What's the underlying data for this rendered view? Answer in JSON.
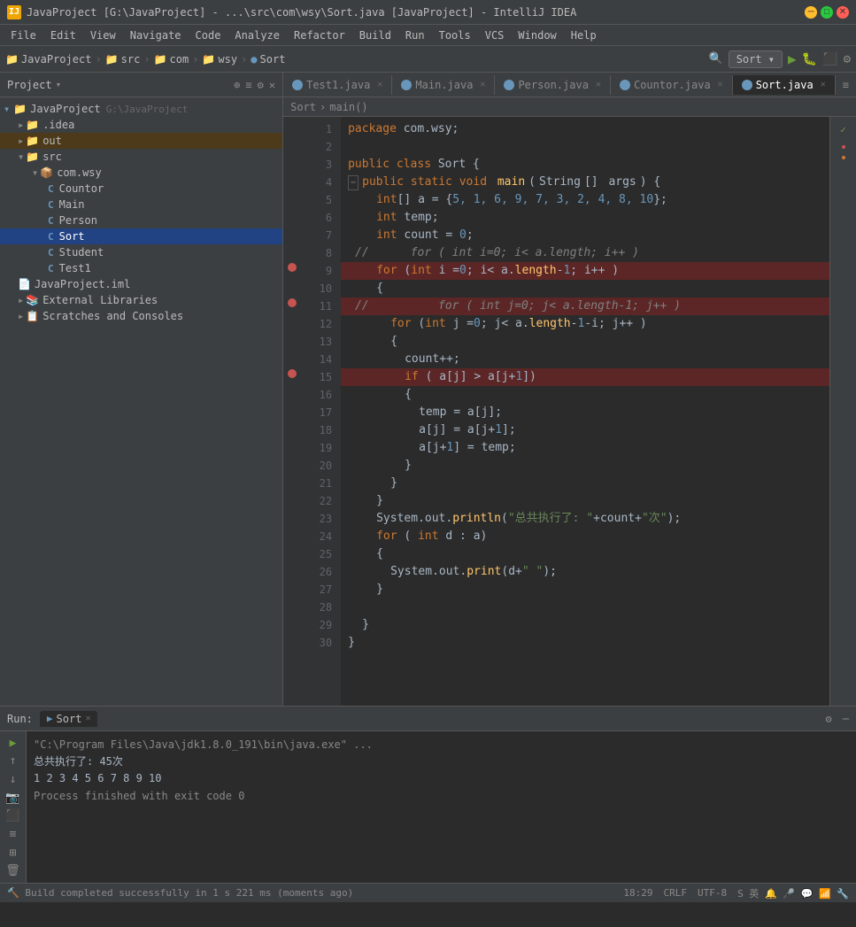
{
  "titleBar": {
    "title": "JavaProject [G:\\JavaProject] - ...\\src\\com\\wsy\\Sort.java [JavaProject] - IntelliJ IDEA",
    "appIconLabel": "IJ"
  },
  "menuBar": {
    "items": [
      "File",
      "Edit",
      "View",
      "Navigate",
      "Code",
      "Analyze",
      "Refactor",
      "Build",
      "Run",
      "Tools",
      "VCS",
      "Window",
      "Help"
    ]
  },
  "navBar": {
    "items": [
      "JavaProject",
      "src",
      "com",
      "wsy",
      "Sort"
    ],
    "sortBtn": "Sort ▾"
  },
  "projectPanel": {
    "title": "Project",
    "tree": [
      {
        "indent": 0,
        "icon": "▾",
        "iconColor": "#6897bb",
        "label": "JavaProject",
        "hint": "G:\\JavaProject",
        "type": "root"
      },
      {
        "indent": 1,
        "icon": "▸",
        "iconColor": "#cc7832",
        "label": ".idea",
        "type": "folder"
      },
      {
        "indent": 1,
        "icon": "▸",
        "iconColor": "#d09b2c",
        "label": "out",
        "type": "folder"
      },
      {
        "indent": 1,
        "icon": "▾",
        "iconColor": "#d09b2c",
        "label": "src",
        "type": "folder"
      },
      {
        "indent": 2,
        "icon": "▾",
        "iconColor": "#d09b2c",
        "label": "com.wsy",
        "type": "folder"
      },
      {
        "indent": 3,
        "icon": "C",
        "iconColor": "#6897bb",
        "label": "Countor",
        "type": "class"
      },
      {
        "indent": 3,
        "icon": "C",
        "iconColor": "#6897bb",
        "label": "Main",
        "type": "class"
      },
      {
        "indent": 3,
        "icon": "C",
        "iconColor": "#6897bb",
        "label": "Person",
        "type": "class"
      },
      {
        "indent": 3,
        "icon": "C",
        "iconColor": "#6897bb",
        "label": "Sort",
        "type": "class",
        "selected": true
      },
      {
        "indent": 3,
        "icon": "C",
        "iconColor": "#6897bb",
        "label": "Student",
        "type": "class"
      },
      {
        "indent": 3,
        "icon": "C",
        "iconColor": "#6897bb",
        "label": "Test1",
        "type": "class"
      },
      {
        "indent": 1,
        "icon": "📄",
        "iconColor": "#bbb",
        "label": "JavaProject.iml",
        "type": "file"
      },
      {
        "indent": 1,
        "icon": "▸",
        "iconColor": "#bbb",
        "label": "External Libraries",
        "type": "folder"
      },
      {
        "indent": 1,
        "icon": "📋",
        "iconColor": "#bbb",
        "label": "Scratches and Consoles",
        "type": "folder"
      }
    ]
  },
  "tabs": [
    {
      "label": "Test1.java",
      "iconColor": "#6897bb",
      "active": false
    },
    {
      "label": "Main.java",
      "iconColor": "#6897bb",
      "active": false
    },
    {
      "label": "Person.java",
      "iconColor": "#6897bb",
      "active": false
    },
    {
      "label": "Countor.java",
      "iconColor": "#6897bb",
      "active": false
    },
    {
      "label": "Sort.java",
      "iconColor": "#6897bb",
      "active": true
    }
  ],
  "breadcrumb": {
    "items": [
      "Sort",
      "›",
      "main()"
    ]
  },
  "codeLines": [
    {
      "num": 1,
      "text": "package com.wsy;",
      "highlight": false,
      "breakpoint": false
    },
    {
      "num": 2,
      "text": "",
      "highlight": false,
      "breakpoint": false
    },
    {
      "num": 3,
      "text": "public class Sort {",
      "highlight": false,
      "breakpoint": false
    },
    {
      "num": 4,
      "text": "    public static void main(String[] args) {",
      "highlight": false,
      "breakpoint": false
    },
    {
      "num": 5,
      "text": "        int[] a = {5, 1, 6, 9, 7, 3, 2, 4, 8, 10};",
      "highlight": false,
      "breakpoint": false
    },
    {
      "num": 6,
      "text": "        int temp;",
      "highlight": false,
      "breakpoint": false
    },
    {
      "num": 7,
      "text": "        int count = 0;",
      "highlight": false,
      "breakpoint": false
    },
    {
      "num": 8,
      "text": "//      for ( int i=0; i< a.length; i++ )",
      "highlight": false,
      "breakpoint": false,
      "comment": true
    },
    {
      "num": 9,
      "text": "        for (int i =0; i< a.length-1; i++ )",
      "highlight": true,
      "breakpoint": true
    },
    {
      "num": 10,
      "text": "        {",
      "highlight": false,
      "breakpoint": false
    },
    {
      "num": 11,
      "text": "//          for ( int j=0; j< a.length-1; j++ )",
      "highlight": true,
      "breakpoint": true,
      "comment": true
    },
    {
      "num": 12,
      "text": "            for (int j =0; j< a.length-1-i; j++ )",
      "highlight": false,
      "breakpoint": false
    },
    {
      "num": 13,
      "text": "            {",
      "highlight": false,
      "breakpoint": false
    },
    {
      "num": 14,
      "text": "                count++;",
      "highlight": false,
      "breakpoint": false
    },
    {
      "num": 15,
      "text": "                if ( a[j] > a[j+1])",
      "highlight": true,
      "breakpoint": true
    },
    {
      "num": 16,
      "text": "                {",
      "highlight": false,
      "breakpoint": false
    },
    {
      "num": 17,
      "text": "                    temp = a[j];",
      "highlight": false,
      "breakpoint": false
    },
    {
      "num": 18,
      "text": "                    a[j] = a[j+1];",
      "highlight": false,
      "breakpoint": false
    },
    {
      "num": 19,
      "text": "                    a[j+1] = temp;",
      "highlight": false,
      "breakpoint": false
    },
    {
      "num": 20,
      "text": "                }",
      "highlight": false,
      "breakpoint": false
    },
    {
      "num": 21,
      "text": "            }",
      "highlight": false,
      "breakpoint": false
    },
    {
      "num": 22,
      "text": "        }",
      "highlight": false,
      "breakpoint": false
    },
    {
      "num": 23,
      "text": "        System.out.println(\"总共执行了: \"+count+\"次\");",
      "highlight": false,
      "breakpoint": false
    },
    {
      "num": 24,
      "text": "        for ( int d : a)",
      "highlight": false,
      "breakpoint": false
    },
    {
      "num": 25,
      "text": "        {",
      "highlight": false,
      "breakpoint": false
    },
    {
      "num": 26,
      "text": "            System.out.print(d+\" \");",
      "highlight": false,
      "breakpoint": false
    },
    {
      "num": 27,
      "text": "        }",
      "highlight": false,
      "breakpoint": false
    },
    {
      "num": 28,
      "text": "",
      "highlight": false,
      "breakpoint": false
    },
    {
      "num": 29,
      "text": "    }",
      "highlight": false,
      "breakpoint": false
    },
    {
      "num": 30,
      "text": "}",
      "highlight": false,
      "breakpoint": false
    }
  ],
  "runPanel": {
    "label": "Run:",
    "tabLabel": "Sort",
    "cmdLine": "\"C:\\Program Files\\Java\\jdk1.8.0_191\\bin\\java.exe\" ...",
    "output1": "总共执行了: 45次",
    "output2": "1 2 3 4 5 6 7 8 9 10",
    "output3": "Process finished with exit code 0"
  },
  "statusBar": {
    "buildMsg": "Build completed successfully in 1 s 221 ms (moments ago)",
    "position": "18:29",
    "lineEnding": "CRLF",
    "encoding": "UTF-8",
    "extras": "S 英"
  }
}
